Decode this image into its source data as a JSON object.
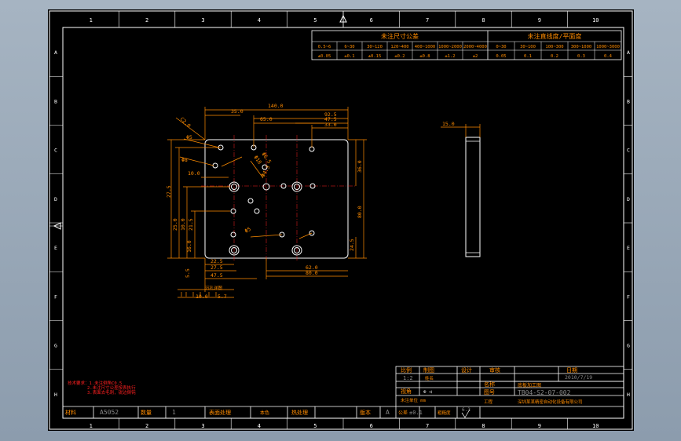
{
  "colors": {
    "border": "#ffffff",
    "dimension": "#ff8c00",
    "red_text": "#ff2020",
    "gray_text": "#8a8a8a",
    "background": "#000000"
  },
  "ruler": {
    "columns": [
      "1",
      "2",
      "3",
      "4",
      "5",
      "6",
      "7",
      "8",
      "9",
      "10"
    ],
    "rows": [
      "A",
      "B",
      "C",
      "D",
      "E",
      "F",
      "G",
      "H"
    ]
  },
  "tolerance_table": {
    "title_left": "未注尺寸公差",
    "title_right": "未注直线度/平面度",
    "ranges": [
      "0.5~6",
      "6~30",
      "30~120",
      "120~400",
      "400~1000",
      "1000~2000",
      "2000~4000",
      "0~30",
      "30~100",
      "100~300",
      "300~1000",
      "1000~3000"
    ],
    "values": [
      "±0.05",
      "±0.1",
      "±0.15",
      "±0.2",
      "±0.8",
      "±1.2",
      "±2",
      "0.05",
      "0.1",
      "0.2",
      "0.3",
      "0.4"
    ]
  },
  "drawing": {
    "dims_top": [
      "140.0",
      "92.5",
      "35.0",
      "65.0",
      "47.5",
      "33.0"
    ],
    "dims_left": [
      "C2.0",
      "Φ5",
      "Φ8",
      "10.0",
      "27.5",
      "25.0",
      "10.0",
      "21.5",
      "16.0",
      "5.5"
    ],
    "dims_right": [
      "36.0",
      "80.0",
      "24.5"
    ],
    "dims_bottom": [
      "22.5",
      "27.5",
      "47.5",
      "62.0",
      "80.0",
      "10.0",
      "5.7"
    ],
    "dims_holes": [
      "Φ10",
      "Φ6.5",
      "Φ4.3",
      "Φ5"
    ],
    "dims_bottom_note": "沉孔详图",
    "side_dim": "15.0"
  },
  "notes": {
    "line1": "技术要求：1.未注倒角C0.5",
    "line2": "2.未注尺寸公差按表执行",
    "line3": "3.表面去毛刺，锐边倒钝"
  },
  "title_block": {
    "scale_label": "比例",
    "scale_value": "1:2",
    "drawn_label": "制图",
    "drawn_value": "姓名",
    "design_label": "设计",
    "check_label": "审核",
    "date_label": "日期",
    "date_value": "2010/7/19",
    "view_label": "视角",
    "name_label": "名称",
    "name_value": "底板加工图",
    "drawing_no_label": "图号",
    "drawing_no_value": "TB04-S2-07-002",
    "material_label": "材料",
    "material_value": "A5052",
    "qty_label": "数量",
    "qty_value": "1",
    "surface_label": "表面处理",
    "surface_value": "本色",
    "heat_label": "热处理",
    "version_label": "版本",
    "version_value": "A",
    "tolerance_label": "公差",
    "tolerance_value": "±0.1",
    "roughness_label": "粗糙度",
    "roughness_value": "6.3",
    "unit_label": "未注单位 mm",
    "project_label": "工程",
    "project_value": "深圳某某精密自动化设备有限公司"
  }
}
